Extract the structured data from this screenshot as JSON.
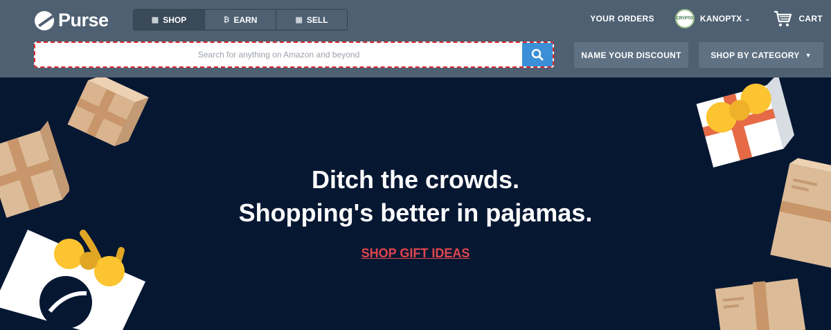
{
  "brand": {
    "name": "Purse",
    "logo_icon": "purse-logo-icon"
  },
  "tabs": [
    {
      "label": "SHOP",
      "icon": "gift-icon",
      "active": true
    },
    {
      "label": "EARN",
      "icon": "bitcoin-icon",
      "active": false
    },
    {
      "label": "SELL",
      "icon": "calculator-icon",
      "active": false
    }
  ],
  "nav": {
    "orders_label": "YOUR ORDERS",
    "username": "KANOPTX",
    "avatar_text": "CRYPTO",
    "cart_label": "CART"
  },
  "search": {
    "placeholder": "Search for anything on Amazon and beyond",
    "value": ""
  },
  "buttons": {
    "discount_label": "NAME YOUR DISCOUNT",
    "category_label": "SHOP BY CATEGORY"
  },
  "hero": {
    "headline_line1": "Ditch the crowds.",
    "headline_line2": "Shopping's better in pajamas.",
    "cta_label": "SHOP GIFT IDEAS"
  },
  "colors": {
    "header_bg": "#4e6072",
    "hero_bg": "#061732",
    "search_button": "#3a8fd6",
    "cta": "#e2464e",
    "focus_outline": "#e0262b"
  }
}
